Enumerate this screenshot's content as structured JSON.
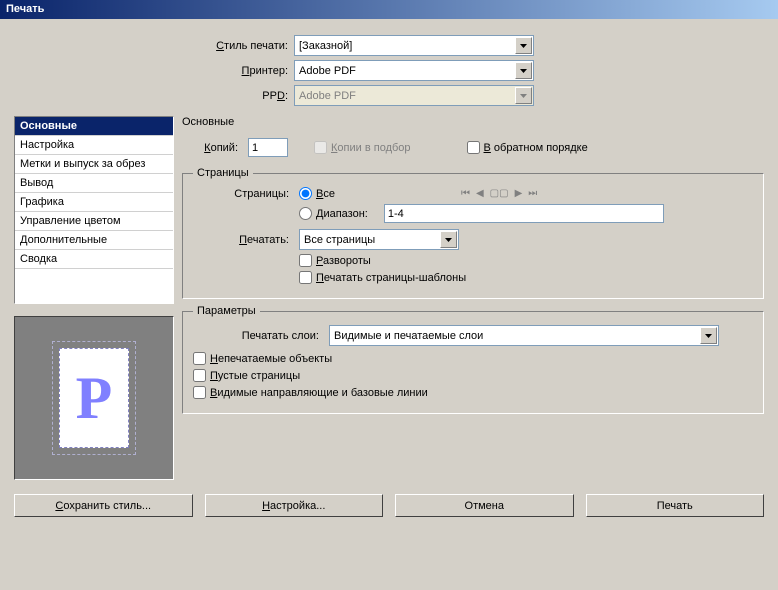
{
  "window": {
    "title": "Печать"
  },
  "top": {
    "style_label": "Стиль печати:",
    "style_value": "[Заказной]",
    "printer_label": "Принтер:",
    "printer_value": "Adobe PDF",
    "ppd_label": "PPD:",
    "ppd_value": "Adobe PDF"
  },
  "sidebar": {
    "items": [
      {
        "label": "Основные"
      },
      {
        "label": "Настройка"
      },
      {
        "label": "Метки и выпуск за обрез"
      },
      {
        "label": "Вывод"
      },
      {
        "label": "Графика"
      },
      {
        "label": "Управление цветом"
      },
      {
        "label": "Дополнительные"
      },
      {
        "label": "Сводка"
      }
    ],
    "preview_letter": "P"
  },
  "panel": {
    "title": "Основные",
    "copies_label": "Копий:",
    "copies_value": "1",
    "collate_label": "Копии в подбор",
    "reverse_label": "В обратном порядке",
    "pages": {
      "legend": "Страницы",
      "pages_label": "Страницы:",
      "all_label": "Все",
      "range_label": "Диапазон:",
      "range_value": "1-4",
      "print_label": "Печатать:",
      "print_value": "Все страницы",
      "spreads_label": "Развороты",
      "master_label": "Печатать страницы-шаблоны"
    },
    "options": {
      "legend": "Параметры",
      "layers_label": "Печатать слои:",
      "layers_value": "Видимые и печатаемые слои",
      "nonprinting_label": "Непечатаемые объекты",
      "blank_label": "Пустые страницы",
      "guides_label": "Видимые направляющие и базовые линии"
    }
  },
  "footer": {
    "save_style": "Сохранить стиль...",
    "settings": "Настройка...",
    "cancel": "Отмена",
    "print": "Печать"
  }
}
